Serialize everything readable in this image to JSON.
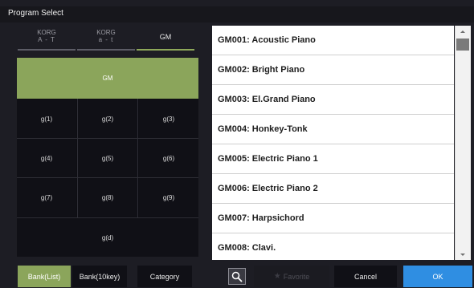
{
  "window": {
    "title": "Program Select"
  },
  "bank_tabs": [
    {
      "line1": "KORG",
      "line2": "A - T"
    },
    {
      "line1": "KORG",
      "line2": "a - t"
    },
    {
      "label": "GM"
    }
  ],
  "bank_grid": {
    "top": "GM",
    "cells": [
      "g(1)",
      "g(2)",
      "g(3)",
      "g(4)",
      "g(5)",
      "g(6)",
      "g(7)",
      "g(8)",
      "g(9)"
    ],
    "bottom": "g(d)"
  },
  "programs": [
    "GM001: Acoustic Piano",
    "GM002: Bright Piano",
    "GM003: El.Grand Piano",
    "GM004: Honkey-Tonk",
    "GM005: Electric Piano 1",
    "GM006: Electric Piano 2",
    "GM007: Harpsichord",
    "GM008: Clavi."
  ],
  "buttons": {
    "bank_list": "Bank(List)",
    "bank_10key": "Bank(10key)",
    "category": "Category",
    "favorite": "Favorite",
    "cancel": "Cancel",
    "ok": "OK"
  },
  "icons": {
    "search": "search-icon",
    "favorite": "star-icon"
  },
  "colors": {
    "accent_green": "#8ba55b",
    "ok_blue": "#2f8ee2",
    "background": "#1d1d24"
  }
}
